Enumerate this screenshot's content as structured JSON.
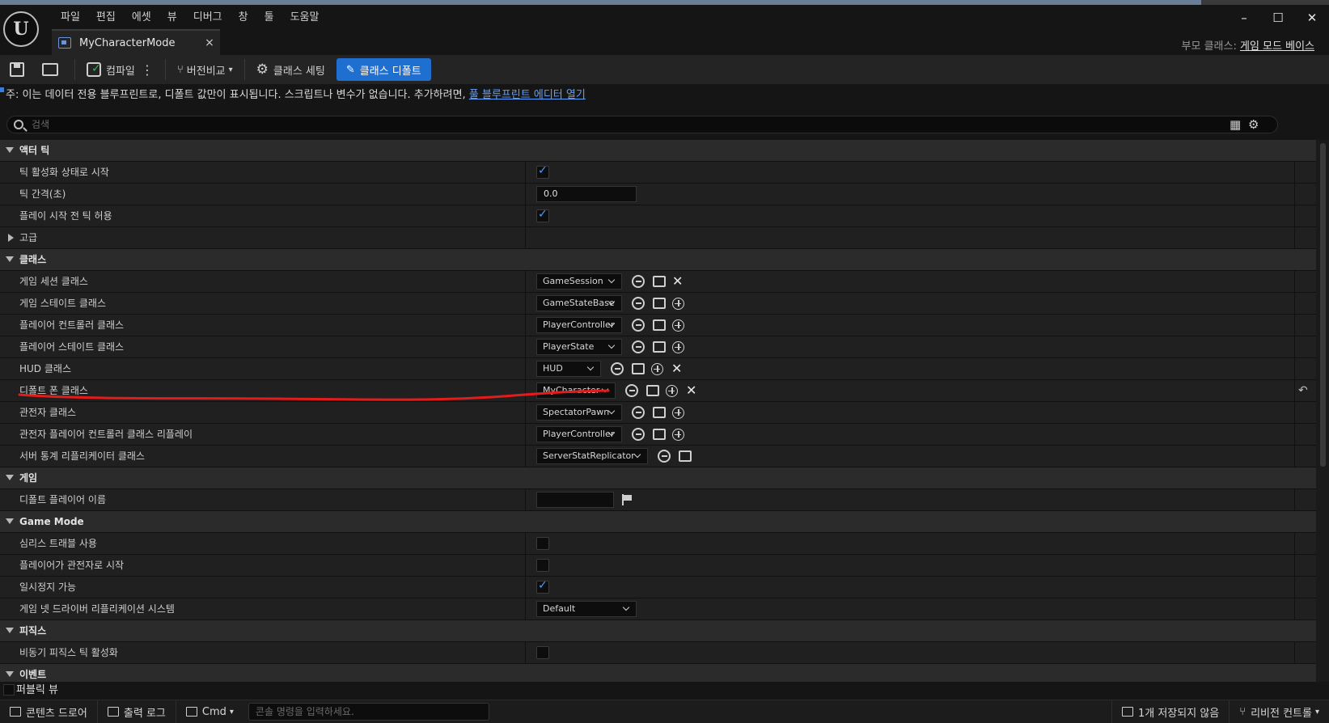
{
  "menu": [
    "파일",
    "편집",
    "에셋",
    "뷰",
    "디버그",
    "창",
    "툴",
    "도움말"
  ],
  "logo_icon": "unreal-logo-icon",
  "window_controls": {
    "minimize": "–",
    "maximize": "☐",
    "close": "✕"
  },
  "tab": {
    "label": "MyCharacterMode",
    "close": "×"
  },
  "parent_class": {
    "label": "부모 클래스:",
    "value": "게임 모드 베이스"
  },
  "toolbar": {
    "compile": "컴파일",
    "diff": "버전비교",
    "class_settings": "클래스 세팅",
    "class_defaults": "클래스 디폴트"
  },
  "notice": {
    "text": "주: 이는 데이터 전용 블루프린트로, 디폴트 값만이 표시됩니다. 스크립트나 변수가 없습니다. 추가하려면,",
    "link": "풀 블루프린트 에디터 열기"
  },
  "search": {
    "placeholder": "검색"
  },
  "sections": {
    "actor_tick": {
      "title": "액터 틱",
      "start_enabled": "틱 활성화 상태로 시작",
      "interval_label": "틱 간격(초)",
      "interval_value": "0.0",
      "allow_before_play": "플레이 시작 전 틱 허용",
      "advanced": "고급"
    },
    "classes": {
      "title": "클래스",
      "game_session": {
        "label": "게임 세션 클래스",
        "value": "GameSession"
      },
      "game_state": {
        "label": "게임 스테이트 클래스",
        "value": "GameStateBase"
      },
      "player_controller": {
        "label": "플레이어 컨트롤러 클래스",
        "value": "PlayerController"
      },
      "player_state": {
        "label": "플레이어 스테이트 클래스",
        "value": "PlayerState"
      },
      "hud": {
        "label": "HUD 클래스",
        "value": "HUD"
      },
      "default_pawn": {
        "label": "디폴트 폰 클래스",
        "value": "MyCharacter"
      },
      "spectator": {
        "label": "관전자 클래스",
        "value": "SpectatorPawn"
      },
      "replay_spectator": {
        "label": "관전자 플레이어 컨트롤러 클래스 리플레이",
        "value": "PlayerController"
      },
      "server_stat": {
        "label": "서버 통계 리플리케이터 클래스",
        "value": "ServerStatReplicator"
      }
    },
    "game": {
      "title": "게임",
      "default_player_name": "디폴트 플레이어 이름"
    },
    "game_mode": {
      "title": "Game Mode",
      "seamless_travel": "심리스 트래블 사용",
      "start_spectator": "플레이어가 관전자로 시작",
      "pausable": "일시정지 가능",
      "net_driver_label": "게임 넷 드라이버 리플리케이션 시스템",
      "net_driver_value": "Default"
    },
    "physics": {
      "title": "피직스",
      "async_tick": "비동기 피직스 틱 활성화"
    },
    "events": {
      "title": "이벤트"
    }
  },
  "public_view": "퍼블릭 뷰",
  "statusbar": {
    "content_drawer": "콘텐츠 드로어",
    "output_log": "출력 로그",
    "cmd": "Cmd",
    "cmd_placeholder": "콘솔 명령을 입력하세요.",
    "unsaved": "1개 저장되지 않음",
    "revision_control": "리비전 컨트롤"
  },
  "colors": {
    "accent": "#1f6fd1",
    "annotation": "#e21b1b"
  }
}
